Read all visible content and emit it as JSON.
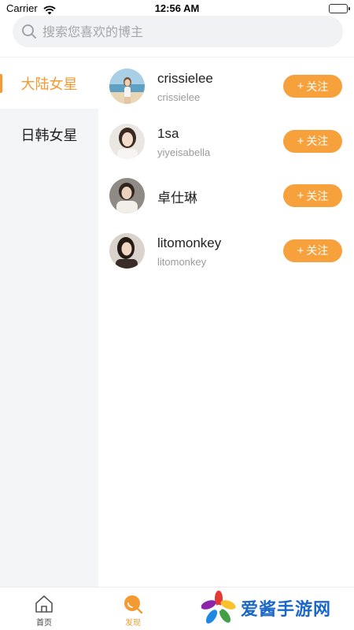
{
  "status_bar": {
    "carrier": "Carrier",
    "time": "12:56 AM"
  },
  "search": {
    "placeholder": "搜索您喜欢的博主"
  },
  "sidebar": {
    "items": [
      {
        "label": "大陆女星",
        "active": true
      },
      {
        "label": "日韩女星",
        "active": false
      }
    ]
  },
  "bloggers": [
    {
      "name": "crissielee",
      "handle": "crissielee",
      "follow_label": "关注",
      "avatar_icon": "avatar-beach"
    },
    {
      "name": "1sa",
      "handle": "yiyeisabella",
      "follow_label": "关注",
      "avatar_icon": "avatar-portrait"
    },
    {
      "name": "卓仕琳",
      "handle": "",
      "follow_label": "关注",
      "avatar_icon": "avatar-portrait"
    },
    {
      "name": "litomonkey",
      "handle": "litomonkey",
      "follow_label": "关注",
      "avatar_icon": "avatar-portrait"
    }
  ],
  "tabbar": {
    "tabs": [
      {
        "label": "首页",
        "icon": "home-icon",
        "active": false
      },
      {
        "label": "发现",
        "icon": "discover-icon",
        "active": true
      }
    ]
  },
  "watermark": {
    "text": "爱酱手游网"
  },
  "colors": {
    "accent": "#f39a32",
    "button": "#f7a13d",
    "sidebar_bg": "#f4f5f7",
    "watermark": "#1b67c7"
  }
}
